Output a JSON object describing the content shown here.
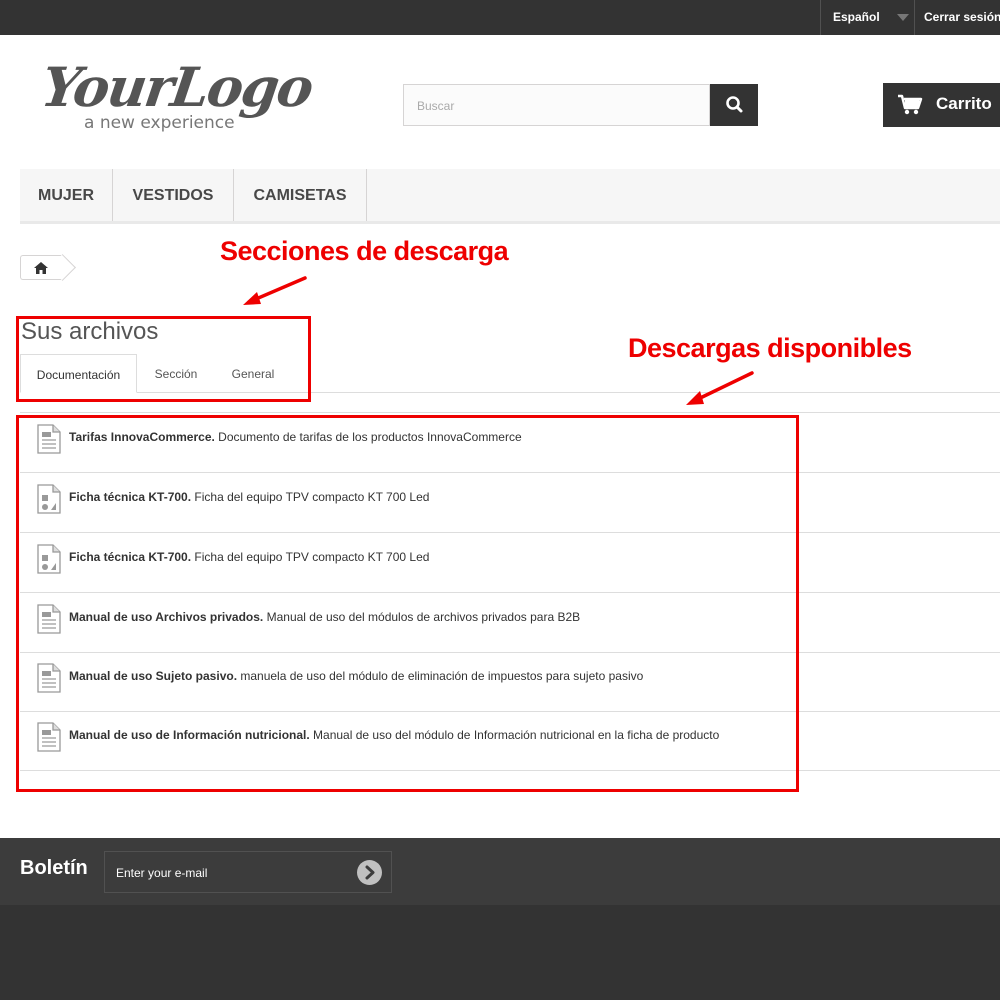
{
  "topbar": {
    "language": "Español",
    "logout": "Cerrar sesión"
  },
  "logo": {
    "script": "YourLogo",
    "tagline": "a new experience"
  },
  "search": {
    "placeholder": "Buscar"
  },
  "cart": {
    "label": "Carrito"
  },
  "menu": {
    "items": [
      "MUJER",
      "VESTIDOS",
      "CAMISETAS"
    ]
  },
  "page": {
    "heading": "Sus archivos"
  },
  "tabs": [
    "Documentación",
    "Sección",
    "General"
  ],
  "files": [
    {
      "icon": "document-icon",
      "title": "Tarifas InnovaCommerce.",
      "desc": " Documento de tarifas de los productos InnovaCommerce"
    },
    {
      "icon": "image-file-icon",
      "title": "Ficha técnica KT-700.",
      "desc": " Ficha del equipo TPV compacto KT 700 Led"
    },
    {
      "icon": "image-file-icon",
      "title": "Ficha técnica KT-700.",
      "desc": " Ficha del equipo TPV compacto KT 700 Led"
    },
    {
      "icon": "document-icon",
      "title": "Manual de uso Archivos privados.",
      "desc": " Manual de uso del módulos de archivos privados para B2B"
    },
    {
      "icon": "document-icon",
      "title": "Manual de uso Sujeto pasivo.",
      "desc": " manuela de uso del módulo de eliminación de impuestos para sujeto pasivo"
    },
    {
      "icon": "document-icon",
      "title": "Manual de uso de Información nutricional.",
      "desc": " Manual de uso del módulo de Información nutricional en la ficha de producto"
    }
  ],
  "annotations": {
    "sections": "Secciones de descarga",
    "downloads": "Descargas disponibles",
    "color": "#ee0000"
  },
  "footer": {
    "newsletter": "Boletín",
    "email_placeholder": "Enter your e-mail"
  }
}
